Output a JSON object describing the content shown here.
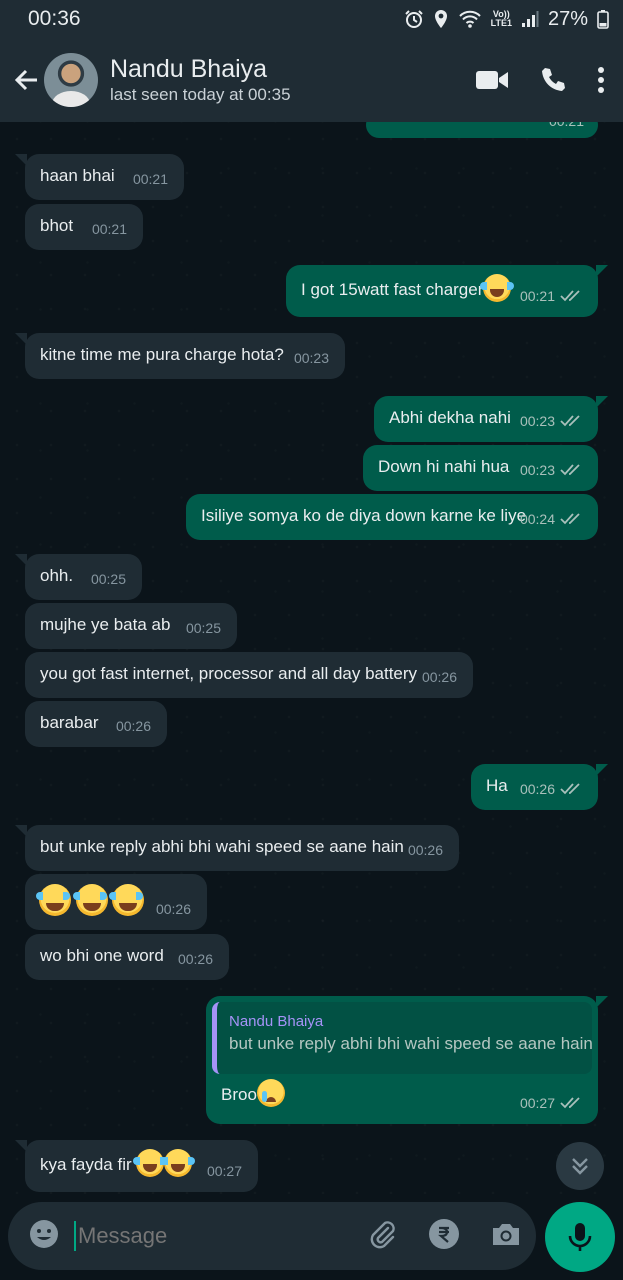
{
  "status_bar": {
    "time": "00:36",
    "lte_top": "Vo))",
    "lte_bottom": "LTE1",
    "battery": "27%"
  },
  "header": {
    "name": "Nandu Bhaiya",
    "status": "last seen today at 00:35"
  },
  "messages": [
    {
      "dir": "in",
      "text": "haan bhai",
      "time": "00:21"
    },
    {
      "dir": "in",
      "text": "bhot",
      "time": "00:21"
    },
    {
      "dir": "out",
      "text": "I got 15watt fast charger",
      "time": "00:21"
    },
    {
      "dir": "in",
      "text": "kitne time me pura charge hota?",
      "time": "00:23"
    },
    {
      "dir": "out",
      "text": "Abhi dekha nahi",
      "time": "00:23"
    },
    {
      "dir": "out",
      "text": "Down hi nahi hua",
      "time": "00:23"
    },
    {
      "dir": "out",
      "text": "Isiliye somya ko de diya down karne ke liye",
      "time": "00:24"
    },
    {
      "dir": "in",
      "text": "ohh.",
      "time": "00:25"
    },
    {
      "dir": "in",
      "text": "mujhe ye bata ab",
      "time": "00:25"
    },
    {
      "dir": "in",
      "text": "you got fast internet, processor and all day battery",
      "time": "00:26"
    },
    {
      "dir": "in",
      "text": "barabar",
      "time": "00:26"
    },
    {
      "dir": "out",
      "text": "Ha",
      "time": "00:26"
    },
    {
      "dir": "in",
      "text": "but unke reply abhi bhi wahi speed se aane hain",
      "time": "00:26"
    },
    {
      "dir": "in",
      "text": "",
      "time": "00:26"
    },
    {
      "dir": "in",
      "text": "wo bhi one word",
      "time": "00:26"
    },
    {
      "dir": "out",
      "text": "Broo",
      "time": "00:27",
      "quote_name": "Nandu Bhaiya",
      "quote_text": "but unke reply abhi bhi wahi speed se aane hain"
    },
    {
      "dir": "in",
      "text": "kya fayda fir",
      "time": "00:27"
    }
  ],
  "input": {
    "placeholder": "Message"
  },
  "colors": {
    "incoming": "#1f2c34",
    "outgoing": "#005c4b",
    "accent": "#00a884",
    "quote_bar": "#a593f7"
  },
  "icons": [
    "back-arrow-icon",
    "video-call-icon",
    "phone-icon",
    "more-vert-icon",
    "double-check-icon",
    "chevron-double-down-icon",
    "emoji-icon",
    "attach-icon",
    "rupee-icon",
    "camera-icon",
    "mic-icon"
  ]
}
